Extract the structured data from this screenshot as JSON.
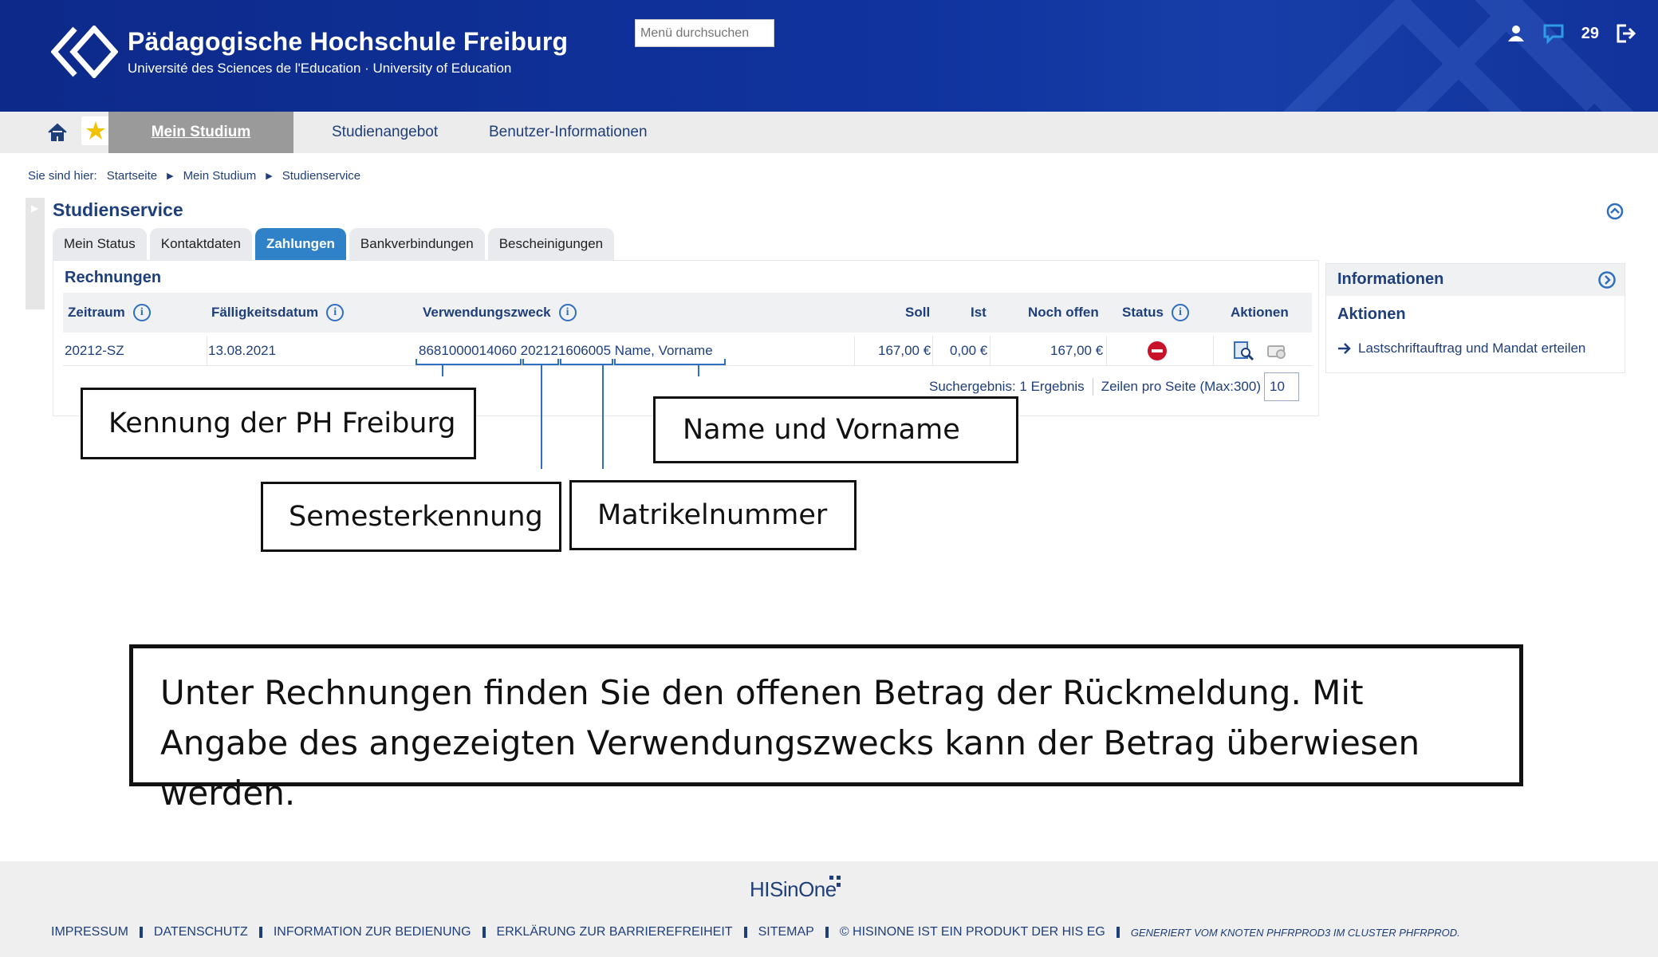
{
  "header": {
    "school_name": "Pädagogische Hochschule Freiburg",
    "school_sub": "Université des Sciences de l'Education · University of Education",
    "search_placeholder": "Menü durchsuchen",
    "message_count": "29"
  },
  "nav": {
    "active": "Mein Studium",
    "items": [
      "Studienangebot",
      "Benutzer-Informationen"
    ]
  },
  "breadcrumb": {
    "prefix": "Sie sind hier:",
    "items": [
      "Startseite",
      "Mein Studium",
      "Studienservice"
    ]
  },
  "page_title": "Studienservice",
  "tabs": [
    "Mein Status",
    "Kontaktdaten",
    "Zahlungen",
    "Bankverbindungen",
    "Bescheinigungen"
  ],
  "active_tab": "Zahlungen",
  "invoices": {
    "title": "Rechnungen",
    "columns": {
      "zeitraum": "Zeitraum",
      "faellig": "Fälligkeitsdatum",
      "zweck": "Verwendungszweck",
      "soll": "Soll",
      "ist": "Ist",
      "offen": "Noch offen",
      "status": "Status",
      "aktionen": "Aktionen"
    },
    "row": {
      "zeitraum": "20212-SZ",
      "faellig": "13.08.2021",
      "zweck": "8681000014060 202121606005 Name, Vorname",
      "soll": "167,00 €",
      "ist": "0,00 €",
      "offen": "167,00 €"
    },
    "result_text": "Suchergebnis: 1 Ergebnis",
    "rows_per_page_label": "Zeilen pro Seite (Max:300)",
    "rows_per_page_value": "10"
  },
  "info_panel": {
    "title": "Informationen",
    "actions_title": "Aktionen",
    "action_link": "Lastschriftauftrag und Mandat erteilen"
  },
  "annotations": {
    "kennung": "Kennung der PH Freiburg",
    "name": "Name und Vorname",
    "semester": "Semesterkennung",
    "matrikel": "Matrikelnummer",
    "explanation": "Unter Rechnungen finden Sie den offenen Betrag der Rückmeldung. Mit Angabe des angezeigten Verwendungszwecks kann der Betrag überwiesen werden."
  },
  "footer": {
    "logo": "HISinOne",
    "links": [
      "IMPRESSUM",
      "DATENSCHUTZ",
      "INFORMATION ZUR BEDIENUNG",
      "ERKLÄRUNG ZUR BARRIEREFREIHEIT",
      "SITEMAP",
      "© HISINONE IST EIN PRODUKT DER HIS EG"
    ],
    "generated": "GENERIERT VOM KNOTEN PHFRPROD3 IM CLUSTER PHFRPROD."
  },
  "colors": {
    "header_blue": "#10339e",
    "link_blue": "#1f3f7a",
    "tab_active": "#2f82c8",
    "status_red": "#c7122a"
  }
}
